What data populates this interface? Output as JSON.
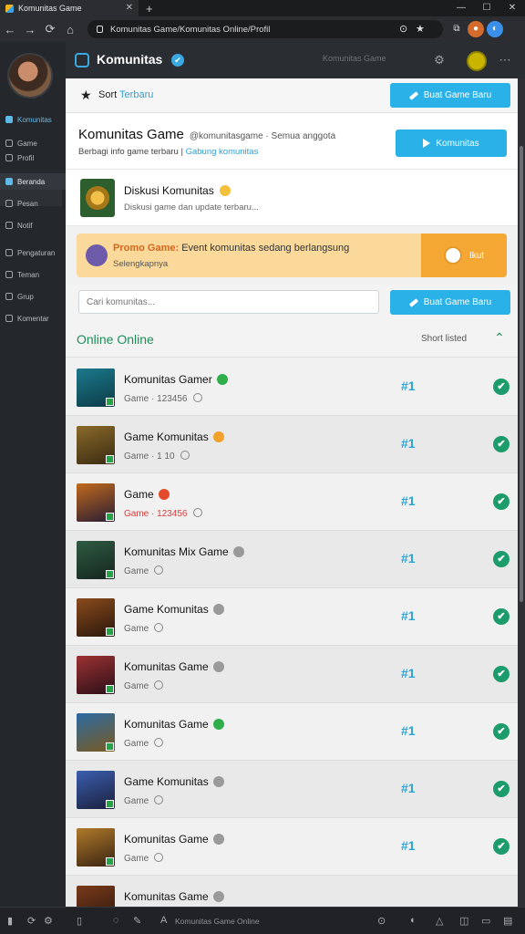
{
  "browser": {
    "tab_title": "Komunitas Game",
    "close_glyph": "✕",
    "newtab_glyph": "+",
    "window_controls": [
      "—",
      "☐",
      "✕"
    ],
    "url": "Komunitas Game/Komunitas Online/Profil",
    "nav_glyphs": [
      "←",
      "→",
      "⟳",
      "⌂"
    ],
    "omni_icons": [
      "⊙",
      "★"
    ],
    "ext_icons": [
      "⧉",
      "●",
      "◐"
    ]
  },
  "sidebar": {
    "items": [
      {
        "label": "Komunitas",
        "accent": true
      },
      {
        "label": "Game",
        "accent": false
      },
      {
        "label": "Profil",
        "accent": false
      },
      {
        "label": "Beranda",
        "accent": true
      },
      {
        "label": "Pesan",
        "accent": false
      },
      {
        "label": "Notif",
        "accent": false
      },
      {
        "label": "Pengaturan",
        "accent": false
      },
      {
        "label": "Teman",
        "accent": false
      },
      {
        "label": "Grup",
        "accent": false
      },
      {
        "label": "Komentar",
        "accent": false
      }
    ]
  },
  "header": {
    "title": "Komunitas",
    "verified_glyph": "✔",
    "search_placeholder": "Komunitas Game",
    "settings_glyph": "⚙",
    "more_glyph": "⋯"
  },
  "sortbar": {
    "star_glyph": "★",
    "label": "Sort",
    "label_accent": "Terbaru",
    "button_label": "Buat Game Baru"
  },
  "main_card": {
    "title": "Komunitas Game",
    "title_note": "@komunitasgame · Semua anggota",
    "subtitle": "Berbagi info game terbaru |",
    "subtitle_link": "Gabung komunitas",
    "button_label": "Komunitas"
  },
  "conversation": {
    "title": "Diskusi Komunitas",
    "subtitle": "Diskusi game dan update terbaru..."
  },
  "promo": {
    "title_bold": "Promo Game:",
    "title_rest": "Event komunitas sedang berlangsung",
    "subtitle": "Selengkapnya",
    "button_label": "Ikut"
  },
  "search": {
    "placeholder": "Cari komunitas..."
  },
  "online": {
    "title": "Online Online",
    "short_label": "Short listed",
    "chevron_glyph": "⌃"
  },
  "colors": {
    "accent_blue": "#29b1e8",
    "online_green": "#1e8f5a",
    "check_green": "#1c9b6b"
  },
  "list": [
    {
      "name": "Komunitas Gamer",
      "status_color": "#2fae4c",
      "meta": "Game · 123456",
      "warn": false,
      "hash": "#1",
      "check": "✔",
      "thumb": [
        "#1b7a8c",
        "#0d3b47"
      ]
    },
    {
      "name": "Game Komunitas",
      "status_color": "#f2a12b",
      "meta": "Game · 1 10",
      "warn": false,
      "hash": "#1",
      "check": "✔",
      "thumb": [
        "#8a6a2a",
        "#3a2a12"
      ]
    },
    {
      "name": "Game",
      "status_color": "#e24a2b",
      "meta": "Game · 123456",
      "warn": true,
      "hash": "#1",
      "check": "✔",
      "thumb": [
        "#c16a1d",
        "#2a1c33"
      ]
    },
    {
      "name": "Komunitas Mix Game",
      "status_color": "",
      "meta": "Game",
      "warn": false,
      "hash": "#1",
      "check": "✔",
      "thumb": [
        "#2f5b43",
        "#14261d"
      ]
    },
    {
      "name": "Game Komunitas",
      "status_color": "",
      "meta": "Game",
      "warn": false,
      "hash": "#1",
      "check": "✔",
      "thumb": [
        "#8a4b1c",
        "#2a170c"
      ]
    },
    {
      "name": "Komunitas Game",
      "status_color": "",
      "meta": "Game",
      "warn": false,
      "hash": "#1",
      "check": "✔",
      "thumb": [
        "#9c3232",
        "#2b0f18"
      ]
    },
    {
      "name": "Komunitas Game",
      "status_color": "#2fae4c",
      "meta": "Game",
      "warn": false,
      "hash": "#1",
      "check": "✔",
      "thumb": [
        "#2b6aa3",
        "#7a5a20"
      ]
    },
    {
      "name": "Game Komunitas",
      "status_color": "",
      "meta": "Game",
      "warn": false,
      "hash": "#1",
      "check": "✔",
      "thumb": [
        "#3a5fb0",
        "#1b1f3c"
      ]
    },
    {
      "name": "Komunitas Game",
      "status_color": "",
      "meta": "Game",
      "warn": false,
      "hash": "#1",
      "check": "✔",
      "thumb": [
        "#b07a2a",
        "#3a2412"
      ]
    },
    {
      "name": "Komunitas Game",
      "status_color": "",
      "meta": "",
      "warn": false,
      "hash": "",
      "check": "",
      "thumb": [
        "#7a3a1a",
        "#2a160c"
      ]
    }
  ],
  "bottombar": {
    "text": "Komunitas Game Online",
    "icons": [
      "▮",
      "⟳",
      "⚙",
      "▯",
      "◌",
      "✎",
      "A",
      "⊙",
      "◐",
      "△",
      "◫",
      "▭",
      "▤"
    ]
  }
}
